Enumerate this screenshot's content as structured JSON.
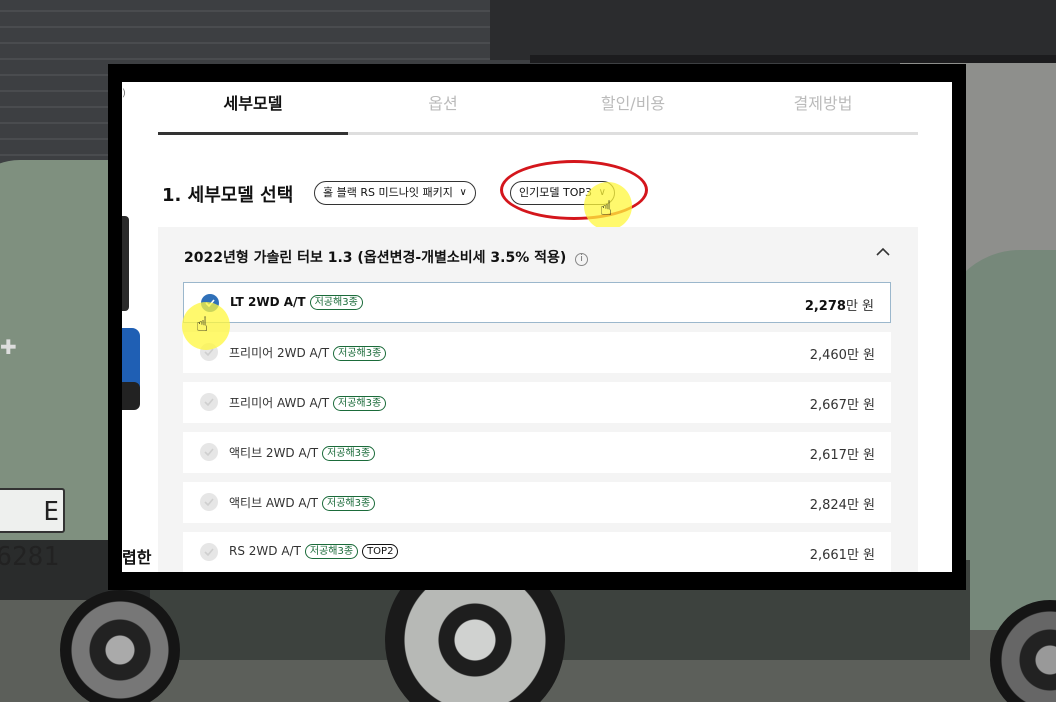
{
  "background": {
    "plate_text": "E 6281"
  },
  "sidebar": {
    "edge_text": "렵한"
  },
  "tabs": [
    {
      "label": "세부모델",
      "active": true
    },
    {
      "label": "옵션",
      "active": false
    },
    {
      "label": "할인/비용",
      "active": false
    },
    {
      "label": "결제방법",
      "active": false
    }
  ],
  "section": {
    "title": "1. 세부모델 선택",
    "package_dropdown": "홀 블랙 RS 미드나잇 패키지",
    "popular_dropdown": "인기모델 TOP3"
  },
  "group": {
    "title": "2022년형 가솔린 터보 1.3 (옵션변경-개별소비세 3.5% 적용)",
    "info_icon": "info-icon",
    "collapse_icon": "chevron-up-icon"
  },
  "trims": [
    {
      "name": "LT 2WD A/T",
      "tags": [
        "저공해3종"
      ],
      "price_num": "2,278",
      "price_unit": "만 원",
      "selected": true
    },
    {
      "name": "프리미어 2WD A/T",
      "tags": [
        "저공해3종"
      ],
      "price_num": "2,460",
      "price_unit": "만 원",
      "selected": false
    },
    {
      "name": "프리미어 AWD A/T",
      "tags": [
        "저공해3종"
      ],
      "price_num": "2,667",
      "price_unit": "만 원",
      "selected": false
    },
    {
      "name": "액티브 2WD A/T",
      "tags": [
        "저공해3종"
      ],
      "price_num": "2,617",
      "price_unit": "만 원",
      "selected": false
    },
    {
      "name": "액티브 AWD A/T",
      "tags": [
        "저공해3종"
      ],
      "price_num": "2,824",
      "price_unit": "만 원",
      "selected": false
    },
    {
      "name": "RS 2WD A/T",
      "tags": [
        "저공해3종",
        "TOP2"
      ],
      "price_num": "2,661",
      "price_unit": "만 원",
      "selected": false
    }
  ],
  "colors": {
    "accent_red": "#d4161c",
    "check_blue": "#2f70b8",
    "tag_green": "#1b6b3a",
    "highlight_yellow": "#fff73c"
  }
}
